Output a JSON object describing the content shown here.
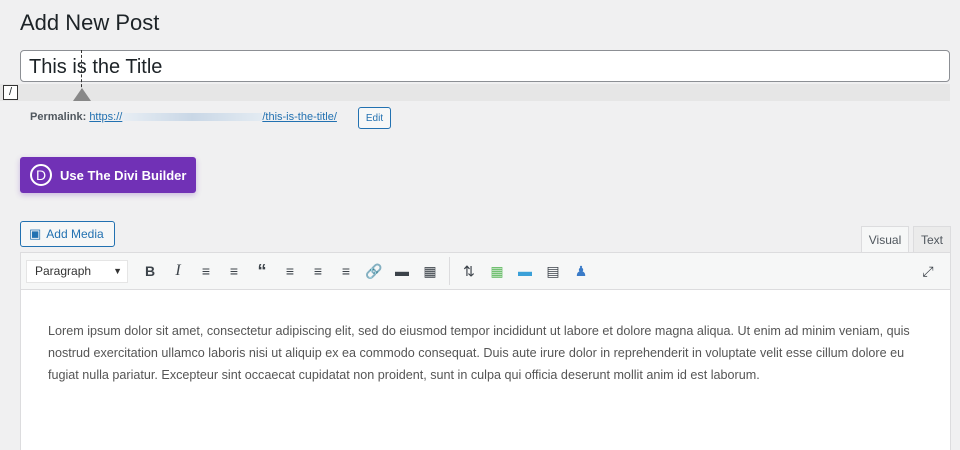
{
  "page_title": "Add New Post",
  "title_input": {
    "value": "This is the Title"
  },
  "permalink": {
    "label": "Permalink:",
    "url_start": "https://",
    "url_end": "/this-is-the-title/",
    "edit_label": "Edit"
  },
  "divi_button": {
    "icon_letter": "D",
    "label": "Use The Divi Builder"
  },
  "add_media": {
    "label": "Add Media"
  },
  "tabs": [
    {
      "label": "Visual",
      "active": true
    },
    {
      "label": "Text",
      "active": false
    }
  ],
  "toolbar": {
    "format_select": "Paragraph"
  },
  "content": "Lorem ipsum dolor sit amet, consectetur adipiscing elit, sed do eiusmod tempor incididunt ut labore et dolore magna aliqua. Ut enim ad minim veniam, quis nostrud exercitation ullamco laboris nisi ut aliquip ex ea commodo consequat. Duis aute irure dolor in reprehenderit in voluptate velit esse cillum dolore eu fugiat nulla pariatur. Excepteur sint occaecat cupidatat non proident, sunt in culpa qui officia deserunt mollit anim id est laborum.",
  "colors": {
    "divi": "#7131b6",
    "link": "#2271b1"
  }
}
